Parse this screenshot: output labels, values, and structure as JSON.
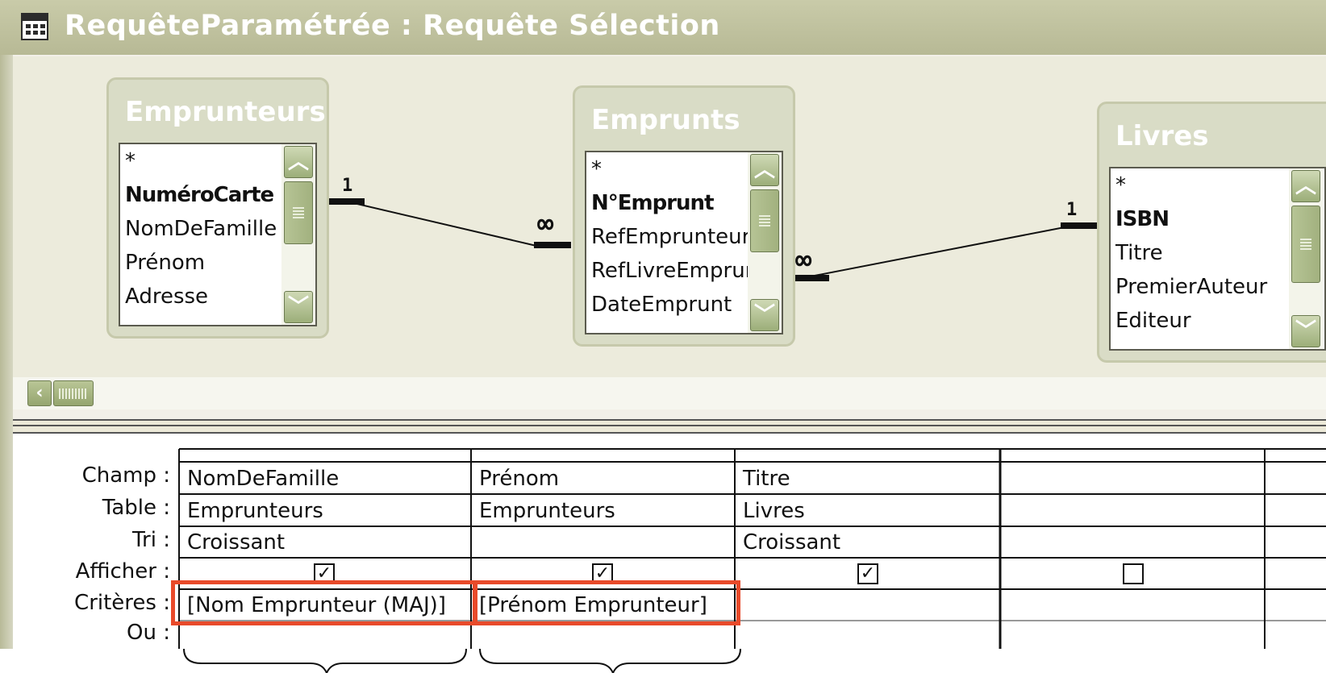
{
  "window": {
    "title": "RequêteParamétrée : Requête Sélection",
    "icon": "query-window-icon"
  },
  "tables": [
    {
      "name": "Emprunteurs",
      "fields": [
        {
          "label": "*",
          "key": false
        },
        {
          "label": "NuméroCarte",
          "key": true
        },
        {
          "label": "NomDeFamille",
          "key": false
        },
        {
          "label": "Prénom",
          "key": false
        },
        {
          "label": "Adresse",
          "key": false
        }
      ]
    },
    {
      "name": "Emprunts",
      "fields": [
        {
          "label": "*",
          "key": false
        },
        {
          "label": "N°Emprunt",
          "key": true
        },
        {
          "label": "RefEmprunteur",
          "key": false
        },
        {
          "label": "RefLivreEmprunte",
          "key": false
        },
        {
          "label": "DateEmprunt",
          "key": false
        }
      ]
    },
    {
      "name": "Livres",
      "fields": [
        {
          "label": "*",
          "key": false
        },
        {
          "label": "ISBN",
          "key": true
        },
        {
          "label": "Titre",
          "key": false
        },
        {
          "label": "PremierAuteur",
          "key": false
        },
        {
          "label": "Editeur",
          "key": false
        }
      ]
    }
  ],
  "relations": [
    {
      "from": "Emprunteurs",
      "to": "Emprunts",
      "from_label": "1",
      "to_label": "∞"
    },
    {
      "from": "Livres",
      "to": "Emprunts",
      "from_label": "1",
      "to_label": "∞"
    }
  ],
  "grid": {
    "row_labels": [
      "Champ :",
      "Table :",
      "Tri :",
      "Afficher :",
      "Critères :",
      "Ou :"
    ],
    "columns": [
      {
        "champ": "NomDeFamille",
        "table": "Emprunteurs",
        "tri": "Croissant",
        "afficher": true,
        "criteres": "[Nom Emprunteur (MAJ)]"
      },
      {
        "champ": "Prénom",
        "table": "Emprunteurs",
        "tri": "",
        "afficher": true,
        "criteres": "[Prénom Emprunteur]"
      },
      {
        "champ": "Titre",
        "table": "Livres",
        "tri": "Croissant",
        "afficher": true,
        "criteres": ""
      },
      {
        "champ": "",
        "table": "",
        "tri": "",
        "afficher": false,
        "criteres": ""
      },
      {
        "champ": "",
        "table": "",
        "tri": "",
        "afficher": false,
        "criteres": ""
      }
    ]
  },
  "colors": {
    "highlight": "#e84a2a",
    "titlebar": "#b7b995",
    "table_header": "#d9dcc6",
    "scroll_accent": "#a2b17f"
  }
}
